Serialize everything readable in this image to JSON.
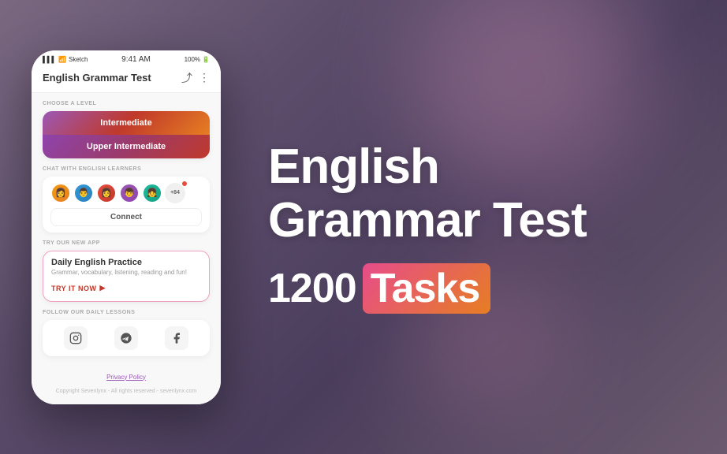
{
  "background": {
    "color1": "#7a6880",
    "color2": "#5c4d6b"
  },
  "phone": {
    "status_bar": {
      "carrier": "Sketch",
      "time": "9:41 AM",
      "battery": "100%"
    },
    "header": {
      "title": "English Grammar Test",
      "share_icon": "share",
      "more_icon": "more"
    },
    "choose_level": {
      "label": "CHOOSE A LEVEL",
      "intermediate": "Intermediate",
      "upper_intermediate": "Upper Intermediate"
    },
    "chat": {
      "label": "CHAT WITH ENGLISH LEARNERS",
      "count": "+84",
      "connect_btn": "Connect"
    },
    "new_app": {
      "label": "TRY OUR NEW APP",
      "title": "Daily English Practice",
      "subtitle": "Grammar, vocabulary, listening, reading and fun!",
      "try_btn": "TRY IT NOW"
    },
    "social": {
      "label": "FOLLOW OUR DAILY LESSONS",
      "instagram": "instagram",
      "telegram": "telegram",
      "facebook": "facebook"
    },
    "footer": {
      "privacy": "Privacy Policy",
      "copyright": "Copyright Sevenlynx - All rights reserved - sevenlynx.com"
    }
  },
  "right": {
    "title_line1": "English",
    "title_line2": "Grammar Test",
    "tasks_number": "1200",
    "tasks_label": "Tasks"
  }
}
